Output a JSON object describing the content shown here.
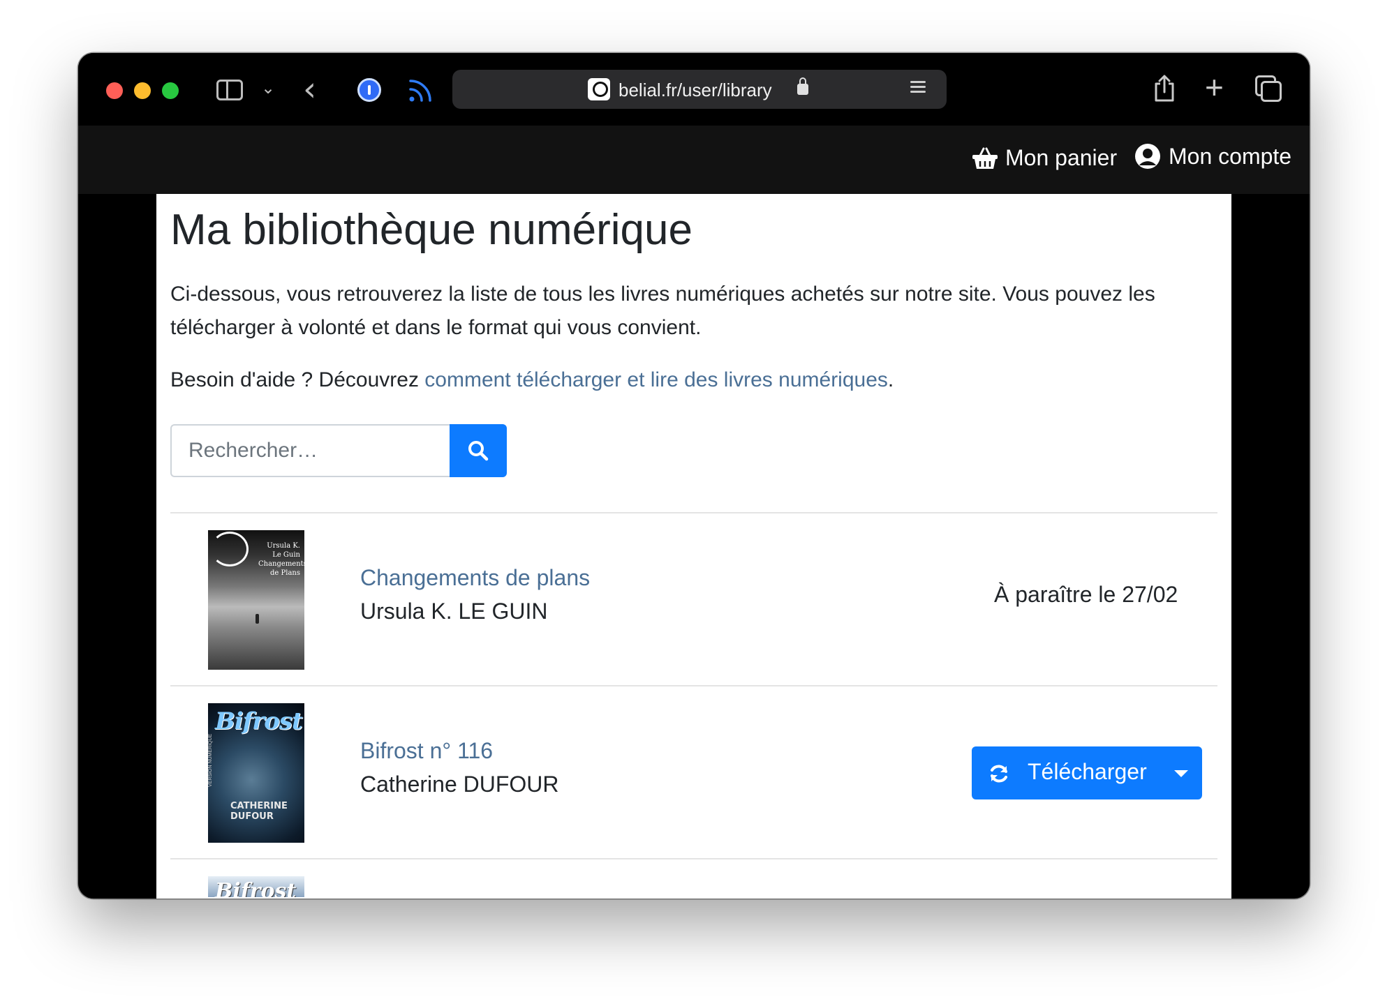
{
  "browser": {
    "url": "belial.fr/user/library"
  },
  "header": {
    "cart_label": "Mon panier",
    "account_label": "Mon compte"
  },
  "page": {
    "title": "Ma bibliothèque numérique",
    "intro": "Ci-dessous, vous retrouverez la liste de tous les livres numériques achetés sur notre site. Vous pouvez les télécharger à volonté et dans le format qui vous convient.",
    "help_prefix": "Besoin d'aide ? Découvrez ",
    "help_link": "comment télécharger et lire des livres numériques",
    "help_suffix": "."
  },
  "search": {
    "placeholder": "Rechercher…"
  },
  "books": [
    {
      "title": "Changements de plans",
      "author": "Ursula K. LE GUIN",
      "status": "À paraître le 27/02",
      "cover_text": "Ursula K. Le Guin Changements de Plans"
    },
    {
      "title": "Bifrost n° 116",
      "author": "Catherine DUFOUR",
      "action_label": "Télécharger",
      "cover_title": "Bifrost",
      "cover_author": "CATHERINE DUFOUR",
      "cover_side": "VERSION NUMÉRIQUE"
    },
    {
      "cover_title": "Bifrost"
    }
  ],
  "colors": {
    "accent": "#0d7bff",
    "link": "#4a6f95",
    "header_bg": "#121212"
  }
}
